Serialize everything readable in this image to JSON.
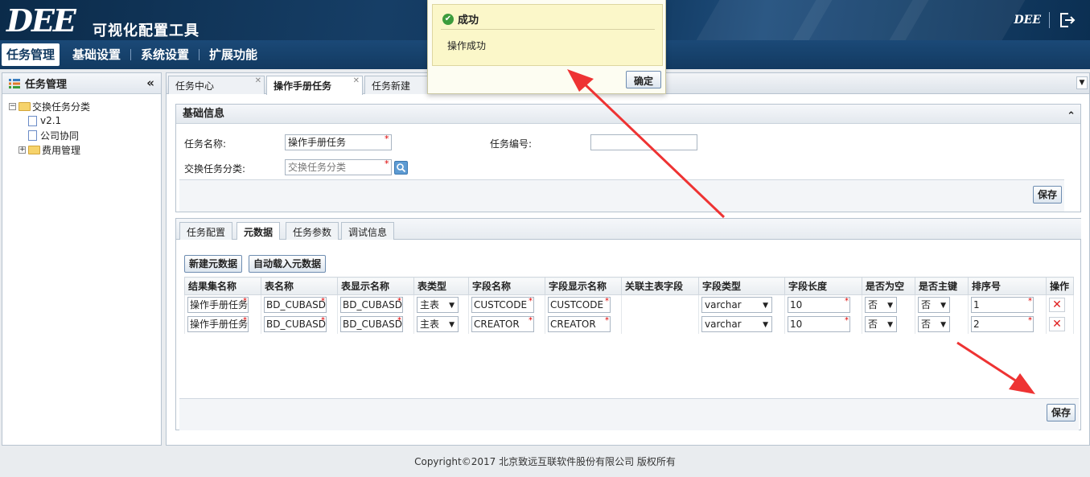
{
  "header": {
    "logo_text": "DEE",
    "app_title": "可视化配置工具",
    "mini_logo": "DEE"
  },
  "nav": {
    "items": [
      "任务管理",
      "基础设置",
      "系统设置",
      "扩展功能"
    ]
  },
  "left_panel": {
    "title": "任务管理",
    "collapse_glyph": "«",
    "tree": {
      "root": "交换任务分类",
      "children": [
        "v2.1",
        "公司协同"
      ],
      "folder2": "费用管理"
    }
  },
  "tabs": {
    "items": [
      "任务中心",
      "操作手册任务",
      "任务新建"
    ]
  },
  "basic_info": {
    "title": "基础信息",
    "task_name_label": "任务名称:",
    "task_name_value": "操作手册任务",
    "task_no_label": "任务编号:",
    "task_no_value": "",
    "category_label": "交换任务分类:",
    "category_placeholder": "交换任务分类",
    "save_label": "保存"
  },
  "subtabs": {
    "items": [
      "任务配置",
      "元数据",
      "任务参数",
      "调试信息"
    ]
  },
  "metadata": {
    "new_button": "新建元数据",
    "auto_load_button": "自动载入元数据",
    "columns": [
      "结果集名称",
      "表名称",
      "表显示名称",
      "表类型",
      "字段名称",
      "字段显示名称",
      "关联主表字段",
      "字段类型",
      "字段长度",
      "是否为空",
      "是否主键",
      "排序号",
      "操作"
    ],
    "rows": [
      {
        "result_set": "操作手册任务",
        "table_name": "BD_CUBASD",
        "table_display": "BD_CUBASD",
        "table_type": "主表",
        "field_name": "CUSTCODE",
        "field_display": "CUSTCODE",
        "rel_field": "",
        "field_type": "varchar",
        "length": "10",
        "nullable": "否",
        "primary": "否",
        "order": "1"
      },
      {
        "result_set": "操作手册任务",
        "table_name": "BD_CUBASD",
        "table_display": "BD_CUBASD",
        "table_type": "主表",
        "field_name": "CREATOR",
        "field_display": "CREATOR",
        "rel_field": "",
        "field_type": "varchar",
        "length": "10",
        "nullable": "否",
        "primary": "否",
        "order": "2"
      }
    ],
    "save_label": "保存"
  },
  "popup": {
    "title": "成功",
    "message": "操作成功",
    "ok_label": "确定"
  },
  "footer": {
    "copyright": "Copyright©2017 北京致远互联软件股份有限公司 版权所有"
  },
  "colors": {
    "header_bg": "#163e66",
    "required_star": "#dd0000",
    "annotation_arrow": "#ee3333"
  }
}
